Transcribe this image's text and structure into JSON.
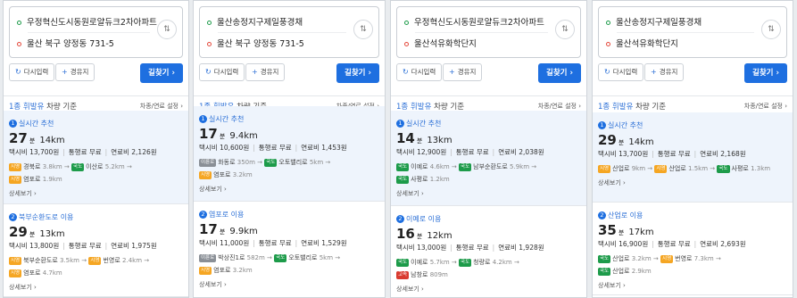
{
  "common": {
    "retry": "다시입력",
    "waypoint": "경유지",
    "go": "길찾기 ›",
    "fuel_prefix": "1종 휘발유",
    "fuel_rest": " 차량 기준",
    "fuel_setting": "차종/연료 설정 ›",
    "detail": "상세보기 ›",
    "time_unit": "분",
    "swap_glyph": "⇅"
  },
  "colors": {
    "orange": "#f5a623",
    "green": "#1d9b4a",
    "gray": "#8a8f96",
    "red": "#d93b30",
    "blue": "#1e6fe0"
  },
  "panels": [
    {
      "from": "우정혁신도시동원로얄듀크2차아파트",
      "to": "울산 북구 양정동 731-5",
      "routes": [
        {
          "tag": "실시간 추천",
          "num": "1",
          "time": "27",
          "dist": "14km",
          "taxi": "택시비 13,700원",
          "toll": "통행료 무료",
          "fuel": "연료비 2,126원",
          "road1": [
            {
              "chip": "시영",
              "color": "#f5a623",
              "name": "경북로",
              "len": "3.8km →"
            },
            {
              "chip": "국도",
              "color": "#1d9b4a",
              "name": "이산로",
              "len": "5.2km →"
            }
          ],
          "road2": [
            {
              "chip": "시영",
              "color": "#f5a623",
              "name": "염포로",
              "len": "1.9km"
            }
          ]
        },
        {
          "tag": "북부순환도로 이용",
          "num": "2",
          "time": "29",
          "dist": "13km",
          "taxi": "택시비 13,800원",
          "toll": "통행료 무료",
          "fuel": "연료비 1,975원",
          "road1": [
            {
              "chip": "시영",
              "color": "#f5a623",
              "name": "북부순환도로",
              "len": "3.5km →"
            },
            {
              "chip": "시영",
              "color": "#f5a623",
              "name": "번영로",
              "len": "2.4km →"
            }
          ],
          "road2": [
            {
              "chip": "시영",
              "color": "#f5a623",
              "name": "염포로",
              "len": "4.7km"
            }
          ]
        }
      ]
    },
    {
      "from": "울산송정지구제일풍경채",
      "to": "울산 북구 양정동 731-5",
      "routes": [
        {
          "tag": "실시간 추천",
          "num": "1",
          "time": "17",
          "dist": "9.4km",
          "taxi": "택시비 10,600원",
          "toll": "통행료 무료",
          "fuel": "연료비 1,453원",
          "road1": [
            {
              "chip": "이륜로",
              "color": "#8a8f96",
              "name": "화동로",
              "len": "350m →"
            },
            {
              "chip": "국도",
              "color": "#1d9b4a",
              "name": "오토밸리로",
              "len": "5km →"
            }
          ],
          "road2": [
            {
              "chip": "시영",
              "color": "#f5a623",
              "name": "염포로",
              "len": "3.2km"
            }
          ]
        },
        {
          "tag": "염포로 이용",
          "num": "2",
          "time": "17",
          "dist": "9.9km",
          "taxi": "택시비 11,000원",
          "toll": "통행료 무료",
          "fuel": "연료비 1,529원",
          "road1": [
            {
              "chip": "이륜로",
              "color": "#8a8f96",
              "name": "박상진1로",
              "len": "582m →"
            },
            {
              "chip": "국도",
              "color": "#1d9b4a",
              "name": "오토밸리로",
              "len": "5km →"
            }
          ],
          "road2": [
            {
              "chip": "시영",
              "color": "#f5a623",
              "name": "염포로",
              "len": "3.2km"
            }
          ]
        }
      ]
    },
    {
      "from": "우정혁신도시동원로얄듀크2차아파트",
      "to": "울산석유화학단지",
      "routes": [
        {
          "tag": "실시간 추천",
          "num": "1",
          "time": "14",
          "dist": "13km",
          "taxi": "택시비 12,900원",
          "toll": "통행료 무료",
          "fuel": "연료비 2,038원",
          "road1": [
            {
              "chip": "국도",
              "color": "#1d9b4a",
              "name": "이예로",
              "len": "4.6km →"
            },
            {
              "chip": "국도",
              "color": "#1d9b4a",
              "name": "남부순환도로",
              "len": "5.9km →"
            }
          ],
          "road2": [
            {
              "chip": "국도",
              "color": "#1d9b4a",
              "name": "사평로",
              "len": "1.2km"
            }
          ]
        },
        {
          "tag": "이예로 이용",
          "num": "2",
          "time": "16",
          "dist": "12km",
          "taxi": "택시비 13,000원",
          "toll": "통행료 무료",
          "fuel": "연료비 1,928원",
          "road1": [
            {
              "chip": "국도",
              "color": "#1d9b4a",
              "name": "이예로",
              "len": "5.7km →"
            },
            {
              "chip": "국도",
              "color": "#1d9b4a",
              "name": "청량로",
              "len": "4.2km →"
            }
          ],
          "road2": [
            {
              "chip": "고속",
              "color": "#d93b30",
              "name": "남창로",
              "len": "809m"
            }
          ]
        }
      ]
    },
    {
      "from": "울산송정지구제일풍경채",
      "to": "울산석유화학단지",
      "routes": [
        {
          "tag": "실시간 추천",
          "num": "1",
          "time": "29",
          "dist": "14km",
          "taxi": "택시비 13,700원",
          "toll": "통행료 무료",
          "fuel": "연료비 2,168원",
          "road1": [
            {
              "chip": "시영",
              "color": "#f5a623",
              "name": "산업로",
              "len": "9km →"
            },
            {
              "chip": "시영",
              "color": "#f5a623",
              "name": "산업로",
              "len": "1.5km →"
            },
            {
              "chip": "국도",
              "color": "#1d9b4a",
              "name": "사평로",
              "len": "1.3km"
            }
          ],
          "road2": []
        },
        {
          "tag": "산업로 이용",
          "num": "2",
          "time": "35",
          "dist": "17km",
          "taxi": "택시비 16,900원",
          "toll": "통행료 무료",
          "fuel": "연료비 2,693원",
          "road1": [
            {
              "chip": "국도",
              "color": "#1d9b4a",
              "name": "산업로",
              "len": "3.2km →"
            },
            {
              "chip": "시영",
              "color": "#f5a623",
              "name": "번영로",
              "len": "7.3km →"
            }
          ],
          "road2": [
            {
              "chip": "국도",
              "color": "#1d9b4a",
              "name": "산업로",
              "len": "2.9km"
            }
          ]
        }
      ]
    }
  ]
}
